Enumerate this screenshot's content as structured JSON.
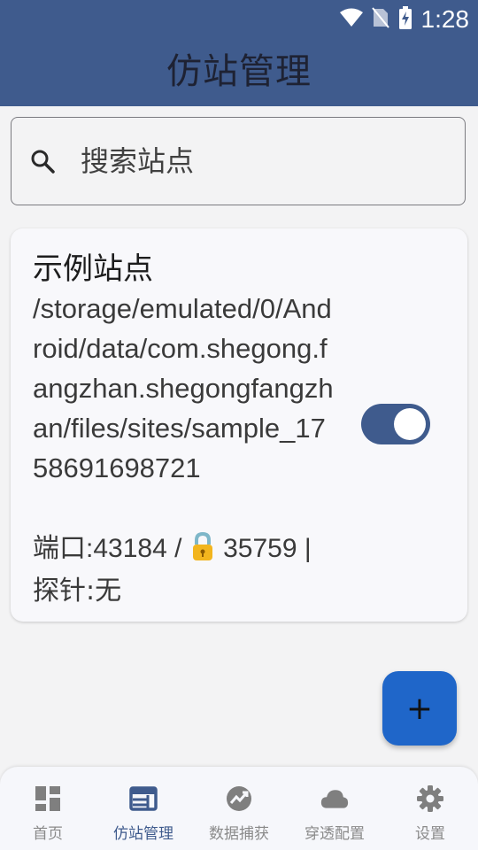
{
  "status_bar": {
    "time": "1:28"
  },
  "header": {
    "title": "仿站管理"
  },
  "search": {
    "placeholder": "搜索站点",
    "value": ""
  },
  "site": {
    "name": "示例站点",
    "path": "/storage/emulated/0/Android/data/com.shegong.fangzhan.shegongfangzhan/files/sites/sample_1758691698721",
    "port_prefix": "端口:43184 / ",
    "lock_icon": "🔒",
    "port_suffix": " 35759 |",
    "probe": "探针:无",
    "enabled": true
  },
  "fab": {
    "label": "+"
  },
  "nav": {
    "items": [
      {
        "label": "首页",
        "icon": "dashboard-icon"
      },
      {
        "label": "仿站管理",
        "icon": "web-icon"
      },
      {
        "label": "数据捕获",
        "icon": "analytics-icon"
      },
      {
        "label": "穿透配置",
        "icon": "cloud-icon"
      },
      {
        "label": "设置",
        "icon": "settings-icon"
      }
    ],
    "active_index": 1
  },
  "colors": {
    "primary": "#3f5b8d",
    "fab": "#1f66c9",
    "background": "#f3f3f4"
  }
}
